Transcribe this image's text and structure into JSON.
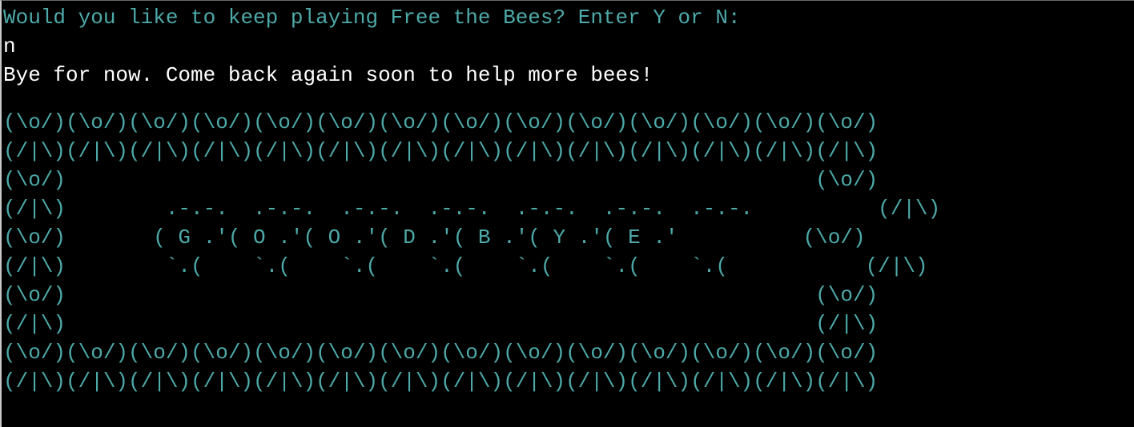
{
  "terminal": {
    "prompt": "Would you like to keep playing Free the Bees? Enter Y or N:",
    "user_input": "n",
    "goodbye": "Bye for now. Come back again soon to help more bees!",
    "art_lines": [
      "(\\o/)(\\o/)(\\o/)(\\o/)(\\o/)(\\o/)(\\o/)(\\o/)(\\o/)(\\o/)(\\o/)(\\o/)(\\o/)(\\o/)",
      "(/|\\)(/|\\)(/|\\)(/|\\)(/|\\)(/|\\)(/|\\)(/|\\)(/|\\)(/|\\)(/|\\)(/|\\)(/|\\)(/|\\)",
      "(\\o/)                                                            (\\o/)",
      "(/|\\)        .-.-.  .-.-.  .-.-.  .-.-.  .-.-.  .-.-.  .-.-.          (/|\\)",
      "(\\o/)       ( G .'( O .'( O .'( D .'( B .'( Y .'( E .'          (\\o/)",
      "(/|\\)        `.(    `.(    `.(    `.(    `.(    `.(    `.(           (/|\\)",
      "(\\o/)                                                            (\\o/)",
      "(/|\\)                                                            (/|\\)",
      "(\\o/)(\\o/)(\\o/)(\\o/)(\\o/)(\\o/)(\\o/)(\\o/)(\\o/)(\\o/)(\\o/)(\\o/)(\\o/)(\\o/)",
      "(/|\\)(/|\\)(/|\\)(/|\\)(/|\\)(/|\\)(/|\\)(/|\\)(/|\\)(/|\\)(/|\\)(/|\\)(/|\\)(/|\\)"
    ]
  },
  "colors": {
    "background": "#000000",
    "teal_text": "#4ea9a9",
    "white_text": "#ffffff"
  }
}
